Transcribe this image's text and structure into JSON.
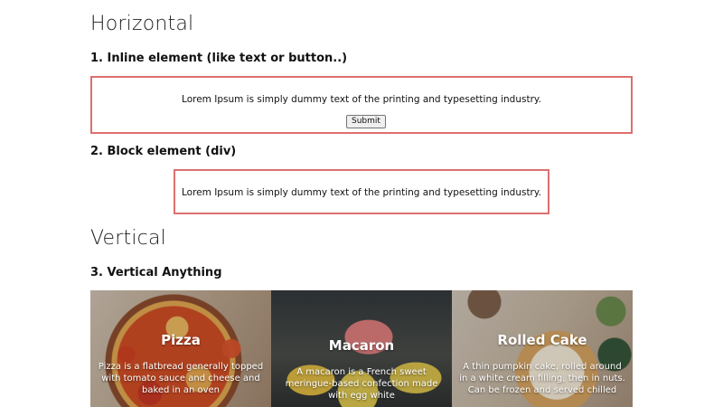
{
  "sections": {
    "horizontal_title": "Horizontal",
    "vertical_title": "Vertical"
  },
  "demos": {
    "inline": {
      "heading": "1. Inline element (like text or button..)",
      "text": "Lorem Ipsum is simply dummy text of the printing and typesetting industry.",
      "button_label": "Submit"
    },
    "block": {
      "heading": "2. Block element (div)",
      "text": "Lorem Ipsum is simply dummy text of the printing and typesetting industry."
    },
    "vertical": {
      "heading": "3. Vertical Anything"
    }
  },
  "cards": [
    {
      "title": "Pizza",
      "description": "Pizza is a flatbread generally topped with tomato sauce and cheese and baked in an oven"
    },
    {
      "title": "Macaron",
      "description": "A macaron is a French sweet meringue-based confection made with egg white"
    },
    {
      "title": "Rolled Cake",
      "description": "A thin pumpkin cake, rolled around in a white cream filling, then in nuts. Can be frozen and served chilled"
    }
  ],
  "colors": {
    "box_border": "#dd6f6f"
  }
}
